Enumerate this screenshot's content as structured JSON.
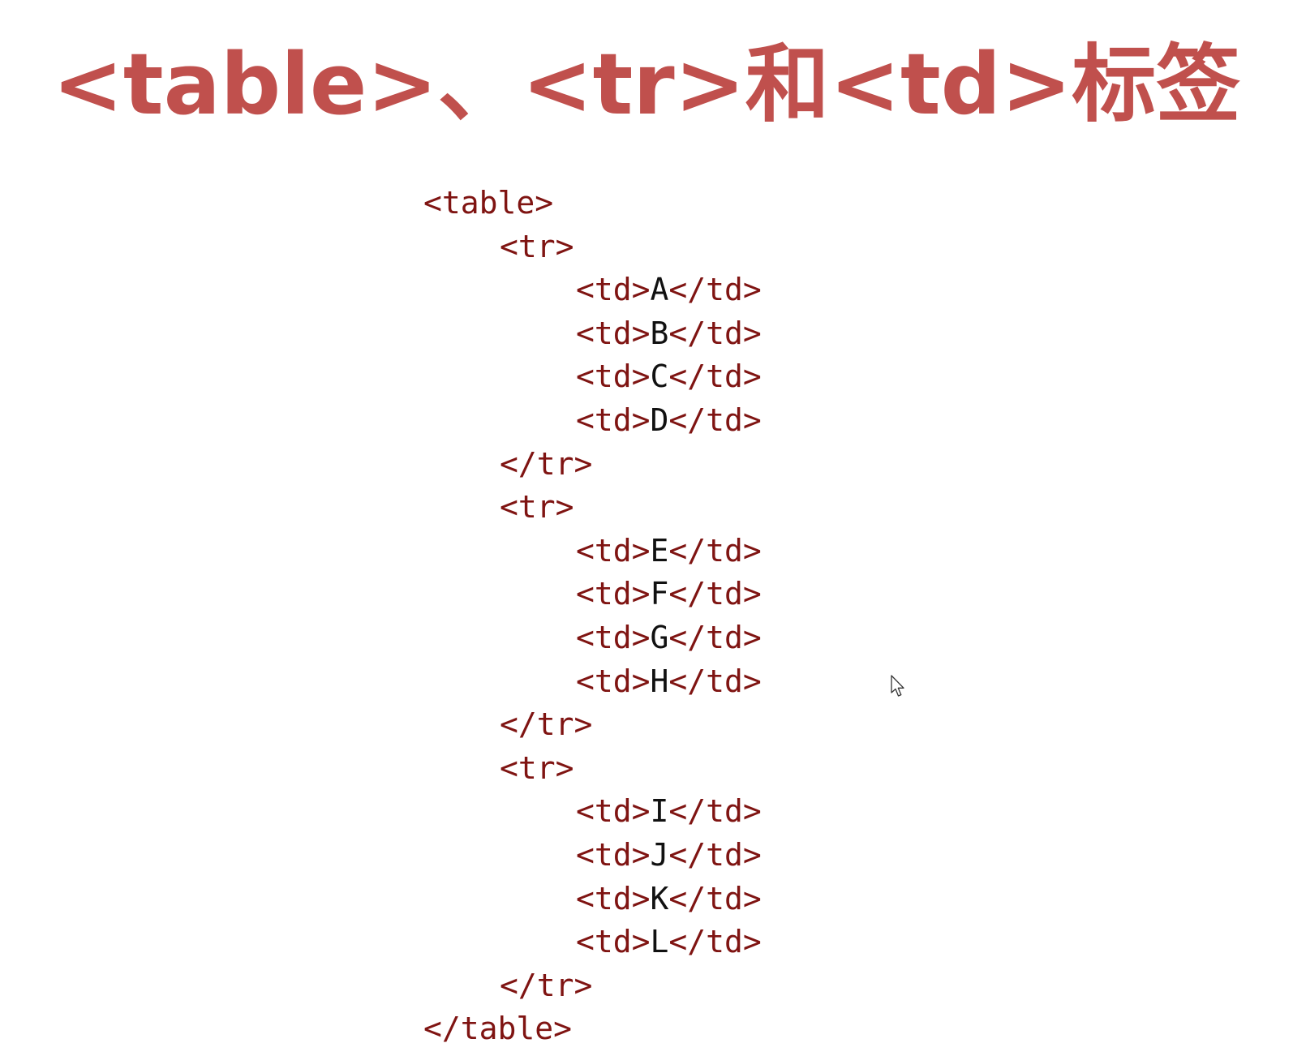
{
  "slide": {
    "title": "<table>、<tr>和<td>标签",
    "code_lines": [
      {
        "indent": 0,
        "tag_open": "<table>",
        "text": "",
        "tag_close": ""
      },
      {
        "indent": 1,
        "tag_open": "<tr>",
        "text": "",
        "tag_close": ""
      },
      {
        "indent": 2,
        "tag_open": "<td>",
        "text": "A",
        "tag_close": "</td>"
      },
      {
        "indent": 2,
        "tag_open": "<td>",
        "text": "B",
        "tag_close": "</td>"
      },
      {
        "indent": 2,
        "tag_open": "<td>",
        "text": "C",
        "tag_close": "</td>"
      },
      {
        "indent": 2,
        "tag_open": "<td>",
        "text": "D",
        "tag_close": "</td>"
      },
      {
        "indent": 1,
        "tag_open": "</tr>",
        "text": "",
        "tag_close": ""
      },
      {
        "indent": 1,
        "tag_open": "<tr>",
        "text": "",
        "tag_close": ""
      },
      {
        "indent": 2,
        "tag_open": "<td>",
        "text": "E",
        "tag_close": "</td>"
      },
      {
        "indent": 2,
        "tag_open": "<td>",
        "text": "F",
        "tag_close": "</td>"
      },
      {
        "indent": 2,
        "tag_open": "<td>",
        "text": "G",
        "tag_close": "</td>"
      },
      {
        "indent": 2,
        "tag_open": "<td>",
        "text": "H",
        "tag_close": "</td>"
      },
      {
        "indent": 1,
        "tag_open": "</tr>",
        "text": "",
        "tag_close": ""
      },
      {
        "indent": 1,
        "tag_open": "<tr>",
        "text": "",
        "tag_close": ""
      },
      {
        "indent": 2,
        "tag_open": "<td>",
        "text": "I",
        "tag_close": "</td>"
      },
      {
        "indent": 2,
        "tag_open": "<td>",
        "text": "J",
        "tag_close": "</td>"
      },
      {
        "indent": 2,
        "tag_open": "<td>",
        "text": "K",
        "tag_close": "</td>"
      },
      {
        "indent": 2,
        "tag_open": "<td>",
        "text": "L",
        "tag_close": "</td>"
      },
      {
        "indent": 1,
        "tag_open": "</tr>",
        "text": "",
        "tag_close": ""
      },
      {
        "indent": 0,
        "tag_open": "</table>",
        "text": "",
        "tag_close": ""
      }
    ]
  },
  "colors": {
    "title": "#c0504d",
    "tag": "#7f1412",
    "cell_text": "#111111",
    "background": "#ffffff"
  },
  "cursor": {
    "icon": "mouse-pointer-icon"
  }
}
